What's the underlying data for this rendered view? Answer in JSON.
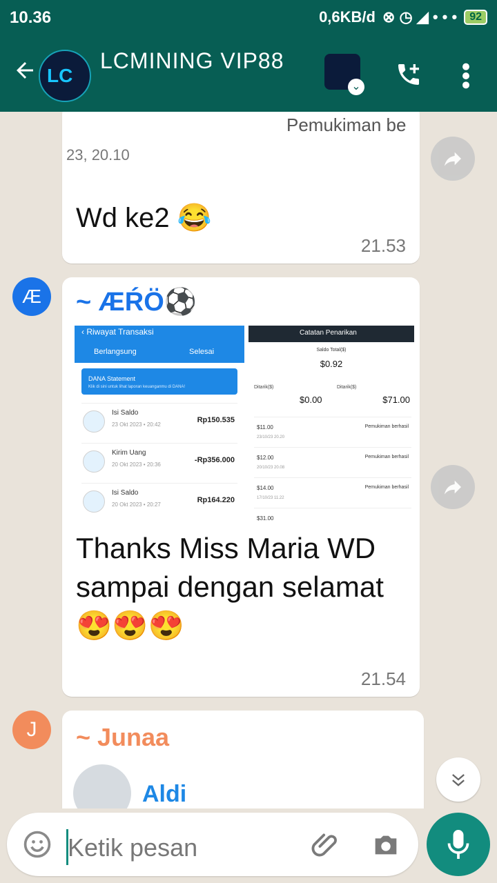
{
  "status": {
    "time": "10.36",
    "speed": "0,6KB/d",
    "battery": "92"
  },
  "header": {
    "title": "LCMINING VIP88",
    "logo_text": "LC"
  },
  "messages": [
    {
      "quote_line1": "Pemukiman be",
      "quote_line2": "23, 20.10",
      "text": "Wd ke2 😂",
      "time": "21.53"
    },
    {
      "avatar": "Æ",
      "sender": "~ ÆŔÖ⚽",
      "screenshot_left": {
        "title": "‹  Riwayat Transaksi",
        "tab1": "Berlangsung",
        "tab2": "Selesai",
        "dana_title": "DANA Statement",
        "dana_sub": "Klik di sini untuk lihat laporan keuanganmu di DANA!",
        "transactions": [
          {
            "label": "Isi Saldo",
            "date": "23 Okt 2023 • 20:42",
            "amount": "Rp150.535"
          },
          {
            "label": "Kirim Uang",
            "date": "20 Okt 2023 • 20:36",
            "amount": "-Rp356.000"
          },
          {
            "label": "Isi Saldo",
            "date": "20 Okt 2023 • 20:27",
            "amount": "Rp164.220"
          }
        ]
      },
      "screenshot_right": {
        "title": "Catatan Penarikan",
        "saldo_label": "Saldo Total($)",
        "saldo_value": "$0.92",
        "left_label": "Ditarik($)",
        "right_label": "Ditarik($)",
        "left_value": "$0.00",
        "right_value": "$71.00",
        "rows": [
          {
            "amount": "$11.00",
            "date": "23/10/23 20.20",
            "status": "Pemukiman berhasil"
          },
          {
            "amount": "$12.00",
            "date": "20/10/23 20.08",
            "status": "Pemukiman berhasil"
          },
          {
            "amount": "$14.00",
            "date": "17/10/23 11.22",
            "status": "Pemukiman berhasil"
          },
          {
            "amount": "$31.00",
            "date": "",
            "status": ""
          }
        ]
      },
      "text": "Thanks Miss Maria WD  sampai dengan selamat  😍😍😍",
      "time": "21.54"
    },
    {
      "avatar": "J",
      "sender": "~ Junaa",
      "quoted_name": "Aldi"
    }
  ],
  "input": {
    "placeholder": "Ketik pesan"
  }
}
